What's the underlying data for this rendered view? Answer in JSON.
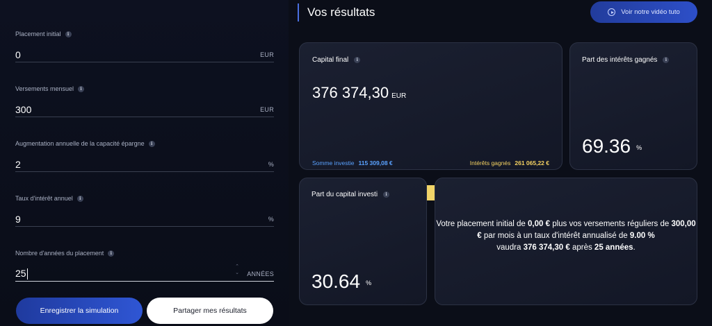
{
  "form": {
    "fields": [
      {
        "label": "Placement initial",
        "value": "0",
        "unit": "EUR"
      },
      {
        "label": "Versements mensuel",
        "value": "300",
        "unit": "EUR"
      },
      {
        "label": "Augmentation annuelle de la capacité épargne",
        "value": "2",
        "unit": "%"
      },
      {
        "label": "Taux d'intérêt annuel",
        "value": "9",
        "unit": "%"
      },
      {
        "label": "Nombre d'années du placement",
        "value": "25",
        "unit": "ANNÉES"
      }
    ],
    "save_label": "Enregistrer la simulation",
    "share_label": "Partager mes résultats"
  },
  "results": {
    "title": "Vos résultats",
    "video_label": "Voir notre vidéo tuto",
    "capital": {
      "label": "Capital final",
      "value": "376 374,30",
      "unit": "EUR",
      "invested_label": "Somme investie",
      "invested_value": "115 309,08 €",
      "interest_label": "Intérêts gagnés",
      "interest_value": "261 065,22 €",
      "invested_share": 0.3064
    },
    "interest_share": {
      "label": "Part des intérêts gagnés",
      "value": "69.36",
      "unit": "%"
    },
    "capital_share": {
      "label": "Part du capital investi",
      "value": "30.64",
      "unit": "%"
    },
    "summary": {
      "p1": "Votre placement initial de ",
      "b1": "0,00 €",
      "p2": " plus vos versements réguliers de ",
      "b2": "300,00 €",
      "p3": " par mois à un taux d'intérêt annualisé de ",
      "b3": "9.00 %",
      "p4": " vaudra ",
      "b4": "376 374,30 €",
      "p5": " après ",
      "b5": "25 années",
      "p6": "."
    }
  },
  "colors": {
    "invested": "#3c8fe6",
    "interest": "#f1d468",
    "accent": "#2f56d4"
  }
}
